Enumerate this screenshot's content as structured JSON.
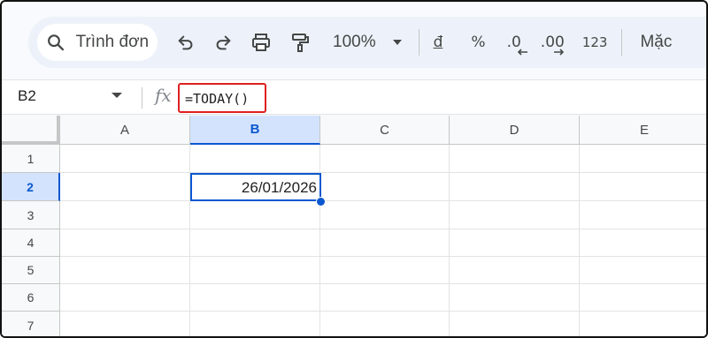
{
  "toolbar": {
    "search_text": "Trình đơn",
    "zoom": "100%",
    "currency_format": "đ",
    "percent_format": "%",
    "decrease_decimal": ".0",
    "increase_decimal": ".00",
    "number_format": "123",
    "font_menu": "Mặc"
  },
  "formula_bar": {
    "name_box": "B2",
    "fx_label": "fx",
    "formula": "=TODAY()"
  },
  "grid": {
    "columns": [
      "A",
      "B",
      "C",
      "D",
      "E"
    ],
    "rows": [
      "1",
      "2",
      "3",
      "4",
      "5",
      "6",
      "7"
    ],
    "selected_column": "B",
    "selected_row": "2",
    "active_cell_value": "26/01/2026"
  },
  "colors": {
    "accent": "#0b57d0",
    "highlight_box": "#e01f1f",
    "toolbar_bg": "#edf2fa"
  }
}
